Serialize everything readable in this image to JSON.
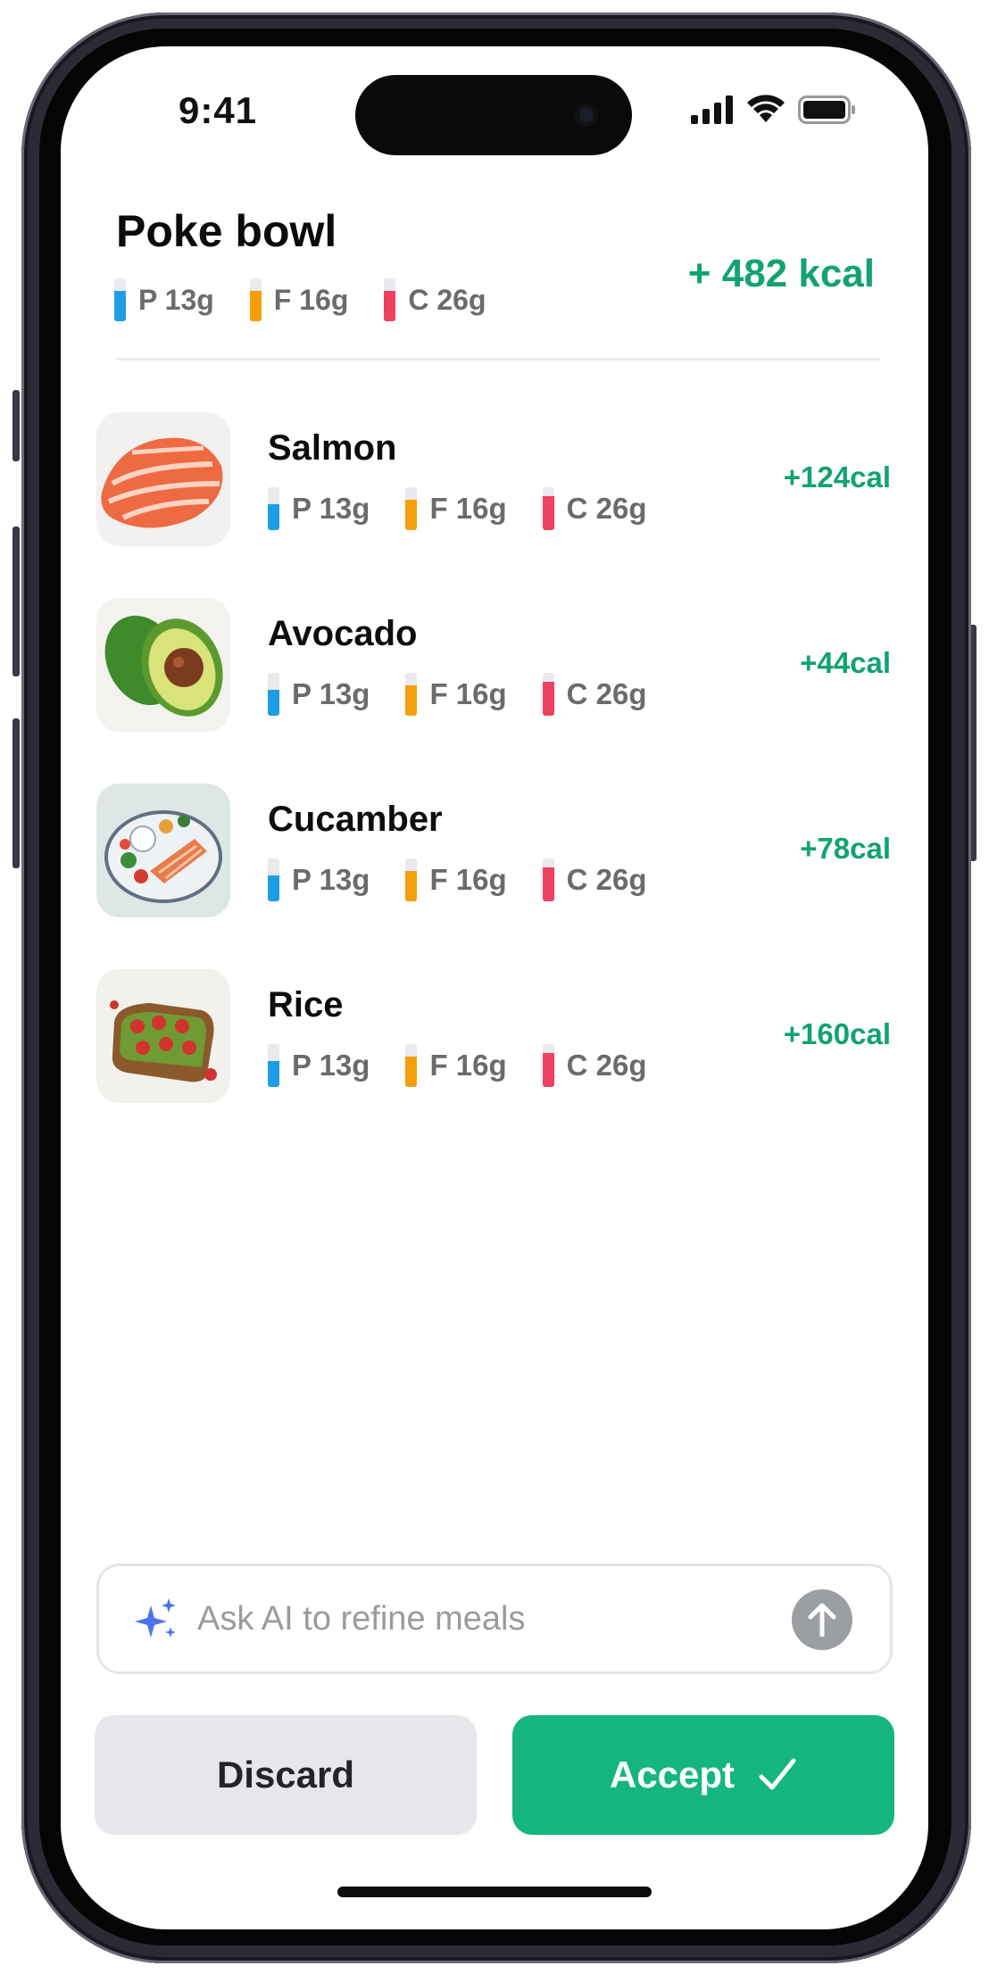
{
  "status_bar": {
    "time": "9:41"
  },
  "meal": {
    "title": "Poke bowl",
    "macros": [
      {
        "label": "P 13g",
        "color": "#1d9de3",
        "fill": 0.7
      },
      {
        "label": "F 16g",
        "color": "#f59e0b",
        "fill": 0.7
      },
      {
        "label": "C 26g",
        "color": "#ef4060",
        "fill": 0.7
      }
    ],
    "total": "+ 482 kcal"
  },
  "foods": [
    {
      "name": "Salmon",
      "calories": "+124cal",
      "image_icon": "salmon-image",
      "macros": [
        {
          "label": "P 13g",
          "color": "#1d9de3",
          "fill": 0.6
        },
        {
          "label": "F 16g",
          "color": "#f59e0b",
          "fill": 0.7
        },
        {
          "label": "C 26g",
          "color": "#ef4060",
          "fill": 0.8
        }
      ]
    },
    {
      "name": "Avocado",
      "calories": "+44cal",
      "image_icon": "avocado-image",
      "macros": [
        {
          "label": "P 13g",
          "color": "#1d9de3",
          "fill": 0.6
        },
        {
          "label": "F 16g",
          "color": "#f59e0b",
          "fill": 0.7
        },
        {
          "label": "C 26g",
          "color": "#ef4060",
          "fill": 0.8
        }
      ]
    },
    {
      "name": "Cucamber",
      "calories": "+78cal",
      "image_icon": "plated-fish-image",
      "macros": [
        {
          "label": "P 13g",
          "color": "#1d9de3",
          "fill": 0.6
        },
        {
          "label": "F 16g",
          "color": "#f59e0b",
          "fill": 0.7
        },
        {
          "label": "C 26g",
          "color": "#ef4060",
          "fill": 0.8
        }
      ]
    },
    {
      "name": "Rice",
      "calories": "+160cal",
      "image_icon": "toast-image",
      "macros": [
        {
          "label": "P 13g",
          "color": "#1d9de3",
          "fill": 0.6
        },
        {
          "label": "F 16g",
          "color": "#f59e0b",
          "fill": 0.7
        },
        {
          "label": "C 26g",
          "color": "#ef4060",
          "fill": 0.8
        }
      ]
    }
  ],
  "ai": {
    "placeholder": "Ask AI to refine meals",
    "spark_icon": "sparkles-icon",
    "send_icon": "arrow-up-icon"
  },
  "actions": {
    "discard": "Discard",
    "accept": "Accept",
    "accept_icon": "checkmark-icon"
  },
  "colors": {
    "accent": "#14b67d",
    "calories": "#12a370",
    "protein": "#1d9de3",
    "fat": "#f59e0b",
    "carbs": "#ef4060"
  }
}
